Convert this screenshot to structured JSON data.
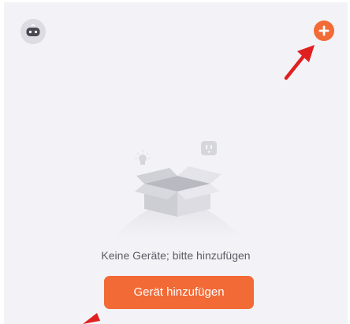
{
  "header": {
    "avatar_icon": "robot-avatar-icon",
    "add_icon": "plus-circle-icon",
    "accent_color": "#f26a36"
  },
  "empty_state": {
    "illustration_icon": "empty-box-icon",
    "message": "Keine Geräte; bitte hinzufügen"
  },
  "actions": {
    "add_device_label": "Gerät hinzufügen"
  },
  "annotations": {
    "arrow_color": "#e02020"
  }
}
